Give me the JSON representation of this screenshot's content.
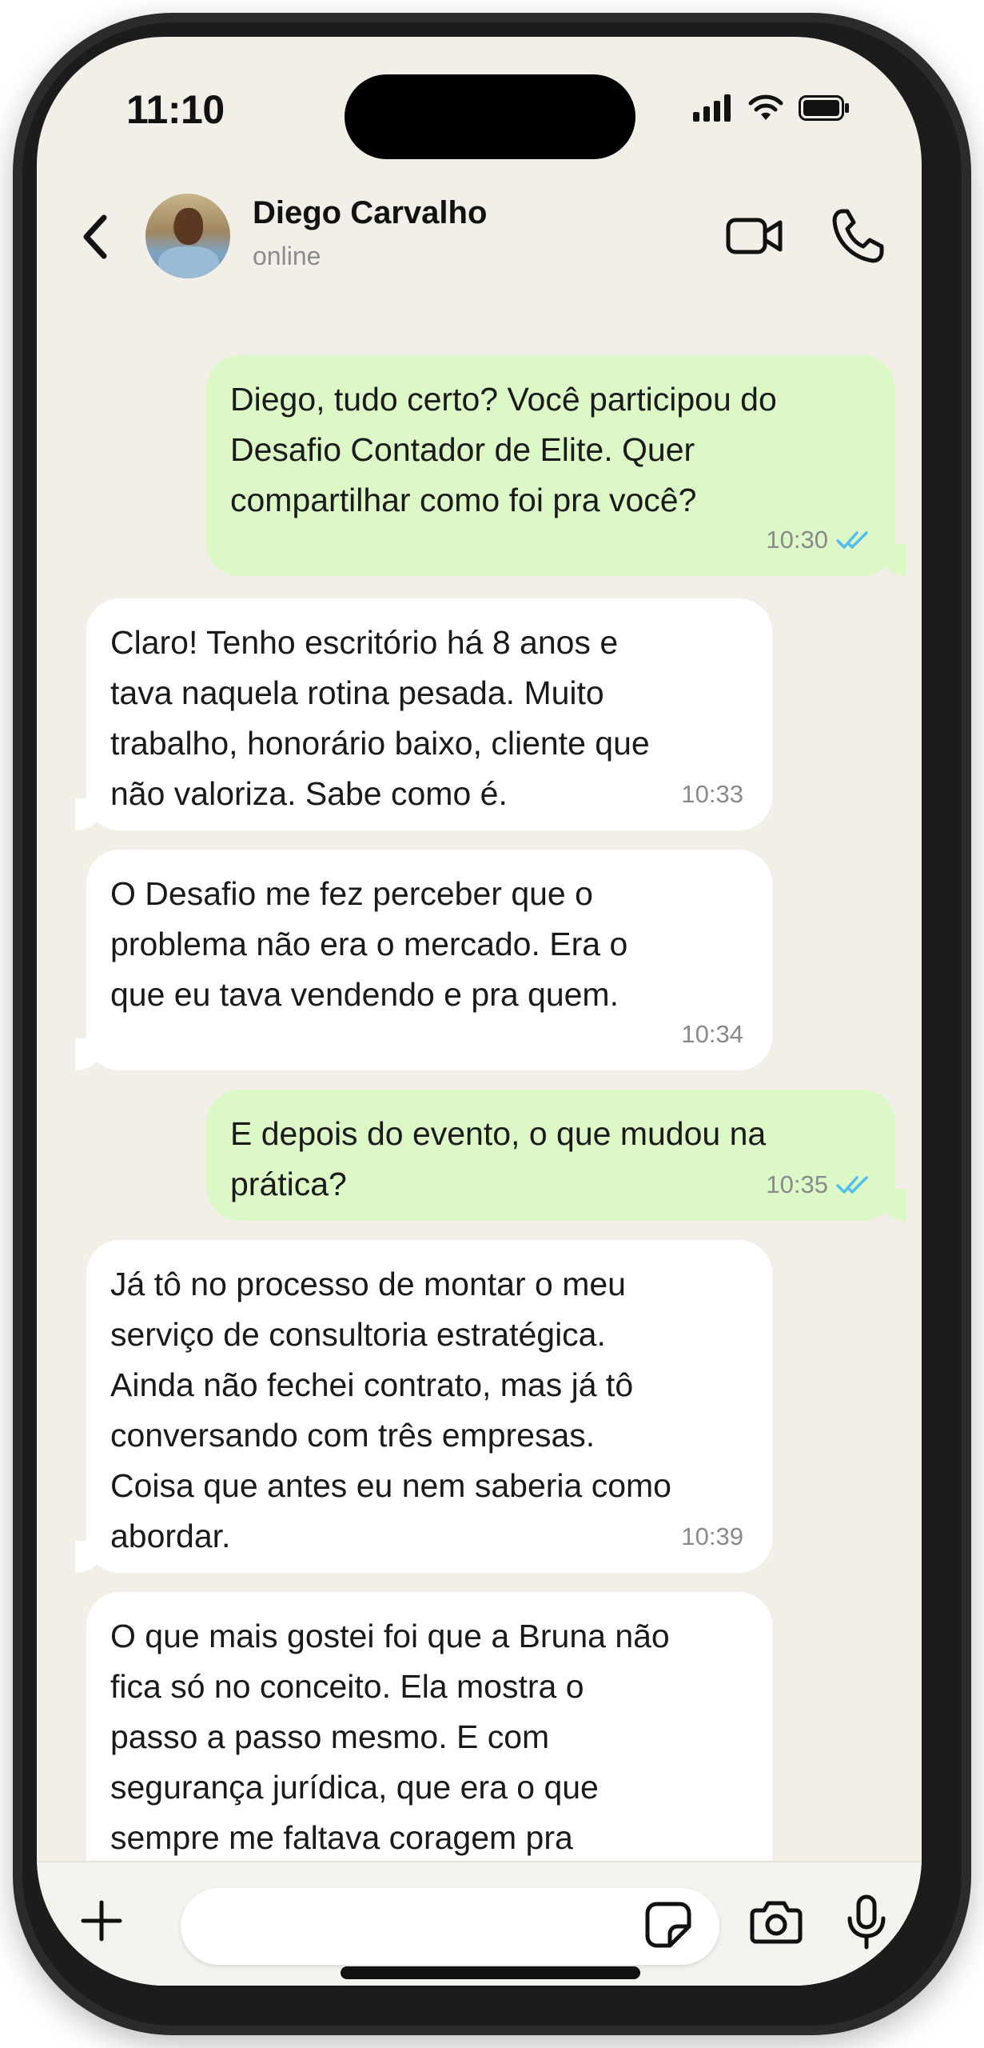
{
  "status_bar": {
    "time": "11:10"
  },
  "header": {
    "contact_name": "Diego Carvalho",
    "contact_status": "online"
  },
  "messages": [
    {
      "direction": "out",
      "lines": [
        "Diego, tudo certo? Você participou do",
        "Desafio Contador de Elite. Quer",
        "compartilhar como foi pra você?"
      ],
      "time": "10:30",
      "read": true
    },
    {
      "direction": "in",
      "lines": [
        "Claro! Tenho escritório há 8 anos e",
        "tava naquela rotina pesada. Muito",
        "trabalho, honorário baixo, cliente que",
        "não valoriza. Sabe como é."
      ],
      "time": "10:33"
    },
    {
      "direction": "in",
      "lines": [
        "O Desafio me fez perceber que o",
        "problema não era o mercado. Era o",
        "que eu tava vendendo e pra quem."
      ],
      "time": "10:34"
    },
    {
      "direction": "out",
      "lines": [
        "E depois do evento, o que mudou na",
        "prática?"
      ],
      "time": "10:35",
      "read": true
    },
    {
      "direction": "in",
      "lines": [
        "Já tô no processo de montar o meu",
        "serviço de consultoria estratégica.",
        "Ainda não fechei contrato, mas já tô",
        "conversando com três empresas.",
        "Coisa que antes eu nem saberia como",
        "abordar."
      ],
      "time": "10:39"
    },
    {
      "direction": "in",
      "lines": [
        "O que mais gostei foi que a Bruna não",
        "fica só no conceito. Ela mostra o",
        "passo a passo mesmo. E com",
        "segurança jurídica, que era o que",
        "sempre me faltava coragem pra"
      ],
      "time": ""
    }
  ],
  "input": {
    "value": "",
    "placeholder": ""
  },
  "colors": {
    "chat_background": "#f2efe9",
    "outgoing_bubble": "#dcf8c6",
    "incoming_bubble": "#ffffff",
    "read_ticks": "#53bdeb"
  },
  "icons": {
    "back": "chevron-left-icon",
    "video": "video-camera-icon",
    "call": "phone-icon",
    "plus": "plus-icon",
    "sticker": "sticker-icon",
    "camera": "camera-icon",
    "mic": "microphone-icon"
  }
}
